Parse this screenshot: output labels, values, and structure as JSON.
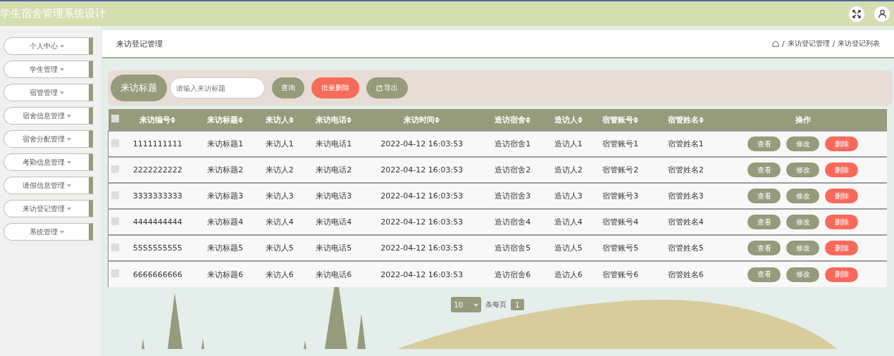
{
  "window": {
    "title": "学生宿舍管理系统设计"
  },
  "sidebar": {
    "items": [
      {
        "label": "个人中心"
      },
      {
        "label": "学生管理"
      },
      {
        "label": "宿管管理"
      },
      {
        "label": "宿舍信息管理"
      },
      {
        "label": "宿舍分配管理"
      },
      {
        "label": "考勤信息管理"
      },
      {
        "label": "请假信息管理"
      },
      {
        "label": "来访登记管理"
      },
      {
        "label": "系统管理"
      }
    ]
  },
  "page_title": "来访登记管理",
  "breadcrumb": {
    "separator": "/",
    "items": [
      "来访登记管理",
      "来访登记列表"
    ]
  },
  "search": {
    "label": "来访标题",
    "placeholder": "请输入来访标题",
    "buttons": [
      {
        "kind": "query",
        "label": "查询"
      },
      {
        "kind": "danger",
        "label": "批量删除"
      },
      {
        "kind": "export",
        "label": "导出"
      }
    ]
  },
  "table": {
    "select_all_checked": false,
    "columns": [
      "来访编号",
      "来访标题",
      "来访人",
      "来访电话",
      "来访时间",
      "造访宿舍",
      "造访人",
      "宿管账号",
      "宿管姓名",
      "操作"
    ],
    "rows": [
      {
        "checked": false,
        "cells": [
          "1111111111",
          "来访标题1",
          "来访人1",
          "来访电话1",
          "2022-04-12 16:03:53",
          "造访宿舍1",
          "造访人1",
          "宿管账号1",
          "宿管姓名1"
        ],
        "actions": [
          {
            "kind": "view",
            "label": "查看"
          },
          {
            "kind": "edit",
            "label": "修改"
          },
          {
            "kind": "delete",
            "label": "删除"
          }
        ]
      },
      {
        "checked": false,
        "cells": [
          "2222222222",
          "来访标题2",
          "来访人2",
          "来访电话2",
          "2022-04-12 16:03:53",
          "造访宿舍2",
          "造访人2",
          "宿管账号2",
          "宿管姓名2"
        ],
        "actions": [
          {
            "kind": "view",
            "label": "查看"
          },
          {
            "kind": "edit",
            "label": "修改"
          },
          {
            "kind": "delete",
            "label": "删除"
          }
        ]
      },
      {
        "checked": false,
        "cells": [
          "3333333333",
          "来访标题3",
          "来访人3",
          "来访电话3",
          "2022-04-12 16:03:53",
          "造访宿舍3",
          "造访人3",
          "宿管账号3",
          "宿管姓名3"
        ],
        "actions": [
          {
            "kind": "view",
            "label": "查看"
          },
          {
            "kind": "edit",
            "label": "修改"
          },
          {
            "kind": "delete",
            "label": "删除"
          }
        ]
      },
      {
        "checked": false,
        "cells": [
          "4444444444",
          "来访标题4",
          "来访人4",
          "来访电话4",
          "2022-04-12 16:03:53",
          "造访宿舍4",
          "造访人4",
          "宿管账号4",
          "宿管姓名4"
        ],
        "actions": [
          {
            "kind": "view",
            "label": "查看"
          },
          {
            "kind": "edit",
            "label": "修改"
          },
          {
            "kind": "delete",
            "label": "删除"
          }
        ]
      },
      {
        "checked": false,
        "cells": [
          "5555555555",
          "来访标题5",
          "来访人5",
          "来访电话5",
          "2022-04-12 16:03:53",
          "造访宿舍5",
          "造访人5",
          "宿管账号5",
          "宿管姓名5"
        ],
        "actions": [
          {
            "kind": "view",
            "label": "查看"
          },
          {
            "kind": "edit",
            "label": "修改"
          },
          {
            "kind": "delete",
            "label": "删除"
          }
        ]
      },
      {
        "checked": false,
        "cells": [
          "6666666666",
          "来访标题6",
          "来访人6",
          "来访电话6",
          "2022-04-12 16:03:53",
          "造访宿舍6",
          "造访人6",
          "宿管账号6",
          "宿管姓名6"
        ],
        "actions": [
          {
            "kind": "view",
            "label": "查看"
          },
          {
            "kind": "edit",
            "label": "修改"
          },
          {
            "kind": "delete",
            "label": "删除"
          }
        ]
      }
    ]
  },
  "pagination": {
    "page_size": "10",
    "page_size_label": "条每页",
    "pages": [
      {
        "label": "1",
        "selected": true
      }
    ]
  }
}
